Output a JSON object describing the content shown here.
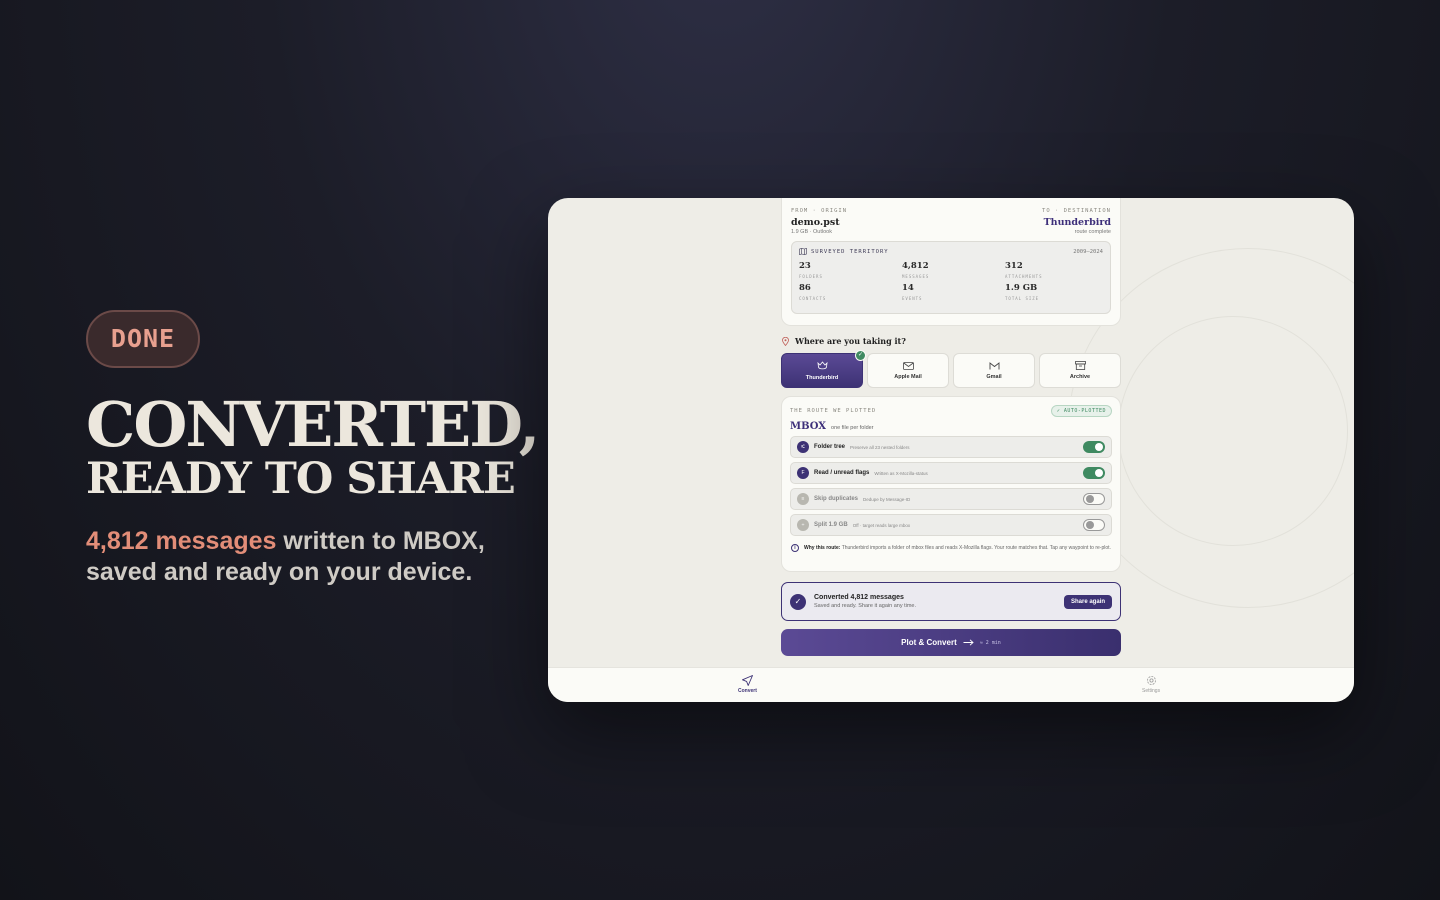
{
  "hero": {
    "badge": "DONE",
    "title_line1": "CONVERTED,",
    "title_line2": "READY TO SHARE",
    "subtitle_accent": "4,812 messages",
    "subtitle_rest1": " written to MBOX,",
    "subtitle_line2": "saved and ready on your device."
  },
  "route": {
    "from_label": "FROM · ORIGIN",
    "from_name": "demo.pst",
    "from_meta": "1.9 GB · Outlook",
    "to_label": "TO · DESTINATION",
    "to_name": "Thunderbird",
    "to_meta": "route complete"
  },
  "territory": {
    "title": "SURVEYED TERRITORY",
    "years": "2009–2024",
    "stats": [
      {
        "value": "23",
        "label": "FOLDERS"
      },
      {
        "value": "4,812",
        "label": "MESSAGES"
      },
      {
        "value": "312",
        "label": "ATTACHMENTS"
      },
      {
        "value": "86",
        "label": "CONTACTS"
      },
      {
        "value": "14",
        "label": "EVENTS"
      },
      {
        "value": "1.9 GB",
        "label": "TOTAL SIZE"
      }
    ]
  },
  "question": "Where are you taking it?",
  "destinations": [
    {
      "label": "Thunderbird",
      "selected": true,
      "icon": "thunderbird-icon"
    },
    {
      "label": "Apple Mail",
      "selected": false,
      "icon": "mail-icon"
    },
    {
      "label": "Gmail",
      "selected": false,
      "icon": "gmail-icon"
    },
    {
      "label": "Archive",
      "selected": false,
      "icon": "archive-icon"
    }
  ],
  "plot": {
    "eyebrow": "THE ROUTE WE PLOTTED",
    "badge": "✓ AUTO-PLOTTED",
    "format": "MBOX",
    "format_sub": "one file per folder",
    "options": [
      {
        "title": "Folder tree",
        "desc": "Preserve all 23 nested folders",
        "on": true,
        "glyph": "⑆"
      },
      {
        "title": "Read / unread flags",
        "desc": "Written as X-Mozilla-status",
        "on": true,
        "glyph": "F"
      },
      {
        "title": "Skip duplicates",
        "desc": "Dedupe by Message-ID",
        "on": false,
        "glyph": "≡"
      },
      {
        "title": "Split 1.9 GB",
        "desc": "Off · target reads large mbox",
        "on": false,
        "glyph": "÷"
      }
    ],
    "why_label": "Why this route:",
    "why_text": " Thunderbird imports a folder of mbox files and reads X-Mozilla flags. Your route matches that. Tap any waypoint to re-plot."
  },
  "converted": {
    "title": "Converted 4,812 messages",
    "sub": "Saved and ready. Share it again any time.",
    "share_label": "Share again"
  },
  "primary": {
    "label": "Plot & Convert",
    "eta": "≈ 2 min"
  },
  "tabs": [
    {
      "label": "Convert",
      "active": true
    },
    {
      "label": "Settings",
      "active": false
    }
  ],
  "colors": {
    "accent": "#3d3275",
    "success": "#3f8a61",
    "hero_accent": "#e28d78"
  }
}
